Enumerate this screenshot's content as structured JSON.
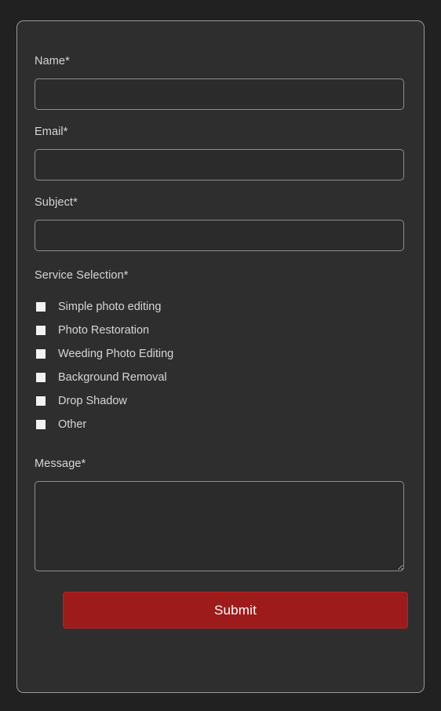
{
  "theme": {
    "page_background": "#212121",
    "card_background": "#2e2e2e",
    "card_border": "#9a9a9a",
    "input_background": "#2b2b2b",
    "input_border": "#8e8e8e",
    "label_color": "#d6d6d6",
    "submit_color": "#9e1b1b",
    "submit_text_color": "#ffffff",
    "checkbox_color": "#f2f2f2"
  },
  "form": {
    "name": {
      "label": "Name*",
      "value": "",
      "placeholder": ""
    },
    "email": {
      "label": "Email*",
      "value": "",
      "placeholder": ""
    },
    "subject": {
      "label": "Subject*",
      "value": "",
      "placeholder": ""
    },
    "service_selection": {
      "label": "Service Selection*",
      "options": [
        {
          "label": "Simple photo editing",
          "checked": false
        },
        {
          "label": "Photo Restoration",
          "checked": false
        },
        {
          "label": "Weeding Photo Editing",
          "checked": false
        },
        {
          "label": "Background Removal",
          "checked": false
        },
        {
          "label": "Drop Shadow",
          "checked": false
        },
        {
          "label": "Other",
          "checked": false
        }
      ]
    },
    "message": {
      "label": "Message*",
      "value": "",
      "placeholder": ""
    },
    "submit": {
      "label": "Submit"
    }
  }
}
